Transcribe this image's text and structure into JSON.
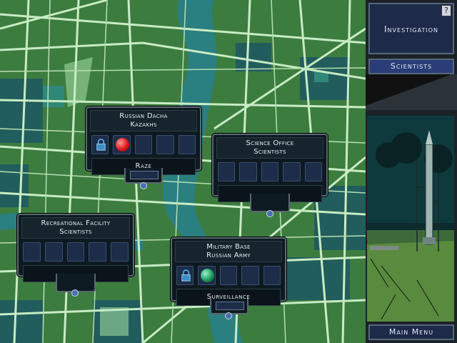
{
  "cards": [
    {
      "id": "dacha",
      "title_line1": "Russian Dacha",
      "title_line2": "Kazakhs",
      "action": "Raze",
      "slots": [
        "lock",
        "red-orb",
        "empty",
        "empty",
        "empty"
      ]
    },
    {
      "id": "science",
      "title_line1": "Science Office",
      "title_line2": "Scientists",
      "slots": [
        "empty",
        "empty",
        "empty",
        "empty",
        "empty"
      ]
    },
    {
      "id": "recreational",
      "title_line1": "Recreational Facility",
      "title_line2": "Scientists",
      "slots": [
        "empty",
        "empty",
        "empty",
        "empty",
        "empty"
      ]
    },
    {
      "id": "military",
      "title_line1": "Military Base",
      "title_line2": "Russian Army",
      "action": "Surveillance",
      "slots": [
        "lock",
        "green-orb",
        "empty",
        "empty",
        "empty"
      ]
    }
  ],
  "sidebar": {
    "investigation_label": "Investigation",
    "help_label": "?",
    "faction_label": "Scientists",
    "main_menu_label": "Main Menu"
  },
  "colors": {
    "map_green": "#3a7a3e",
    "road": "#c6e8c2",
    "river": "#2a7f80",
    "slot": "#1d2c48",
    "panel": "#0d1a22"
  }
}
